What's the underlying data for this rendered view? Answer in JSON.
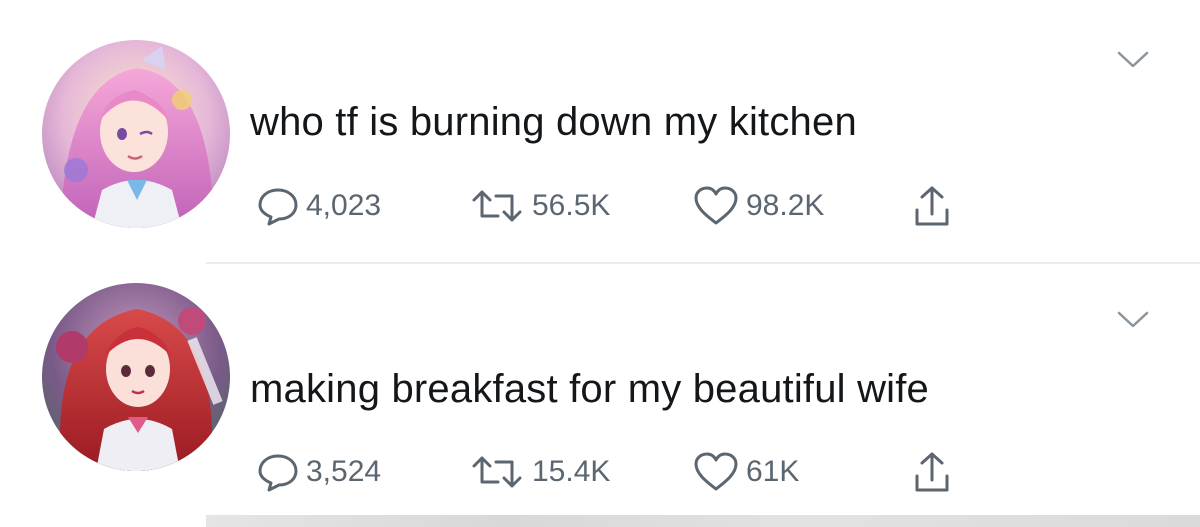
{
  "tweets": [
    {
      "text": "who tf is burning down my kitchen",
      "replies": "4,023",
      "retweets": "56.5K",
      "likes": "98.2K"
    },
    {
      "text": "making breakfast for my beautiful wife",
      "replies": "3,524",
      "retweets": "15.4K",
      "likes": "61K"
    }
  ],
  "icons": {
    "reply": "speech-bubble-icon",
    "retweet": "retweet-icon",
    "like": "heart-icon",
    "share": "share-icon",
    "caret": "chevron-down-icon"
  },
  "colors": {
    "text": "#14171a",
    "icon": "#5b6670",
    "divider": "#e6ecf0"
  }
}
